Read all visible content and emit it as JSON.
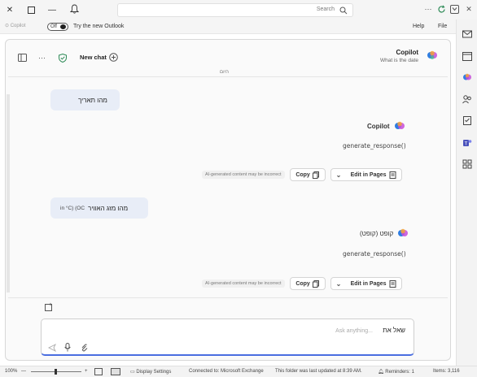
{
  "titlebar": {
    "search_placeholder": "Search"
  },
  "menubar": {
    "items": [
      "File",
      "Help"
    ],
    "try_new_outlook": "Try the new Outlook",
    "toggle_label": "Off",
    "copilot_chip": "Copilot"
  },
  "copilot_header": {
    "title": "Copilot",
    "subtitle": "What is the date",
    "new_chat": "New chat",
    "date_divider": "היום"
  },
  "conversation": [
    {
      "role": "user",
      "text": "מהו תאריך"
    },
    {
      "role": "assistant",
      "name": "Copilot",
      "text": "generate_response()",
      "edit_in_pages": "Edit in Pages",
      "copy": "Copy",
      "ai_note": "AI-generated content may be incorrect"
    },
    {
      "role": "user",
      "text": "מהו מזג האוויר",
      "suffix": "in °C) (OC"
    },
    {
      "role": "assistant",
      "name": "קופט (קופט)",
      "text": "generate_response()",
      "edit_in_pages": "Edit in Pages",
      "copy": "Copy",
      "ai_note": "AI-generated content may be incorrect"
    }
  ],
  "composer": {
    "text": "שאל את",
    "placeholder": "Ask anything..."
  },
  "statusbar": {
    "items": "Items: 3,116",
    "reminders": "Reminders: 1",
    "folder_status": "This folder was last updated at 8:39 AM.",
    "connected": "Connected to: Microsoft Exchange",
    "display_settings": "Display Settings",
    "zoom": "100%"
  },
  "colors": {
    "accent": "#4a6ee0",
    "bubble": "#e8edf7",
    "shield": "#2e8b57"
  }
}
